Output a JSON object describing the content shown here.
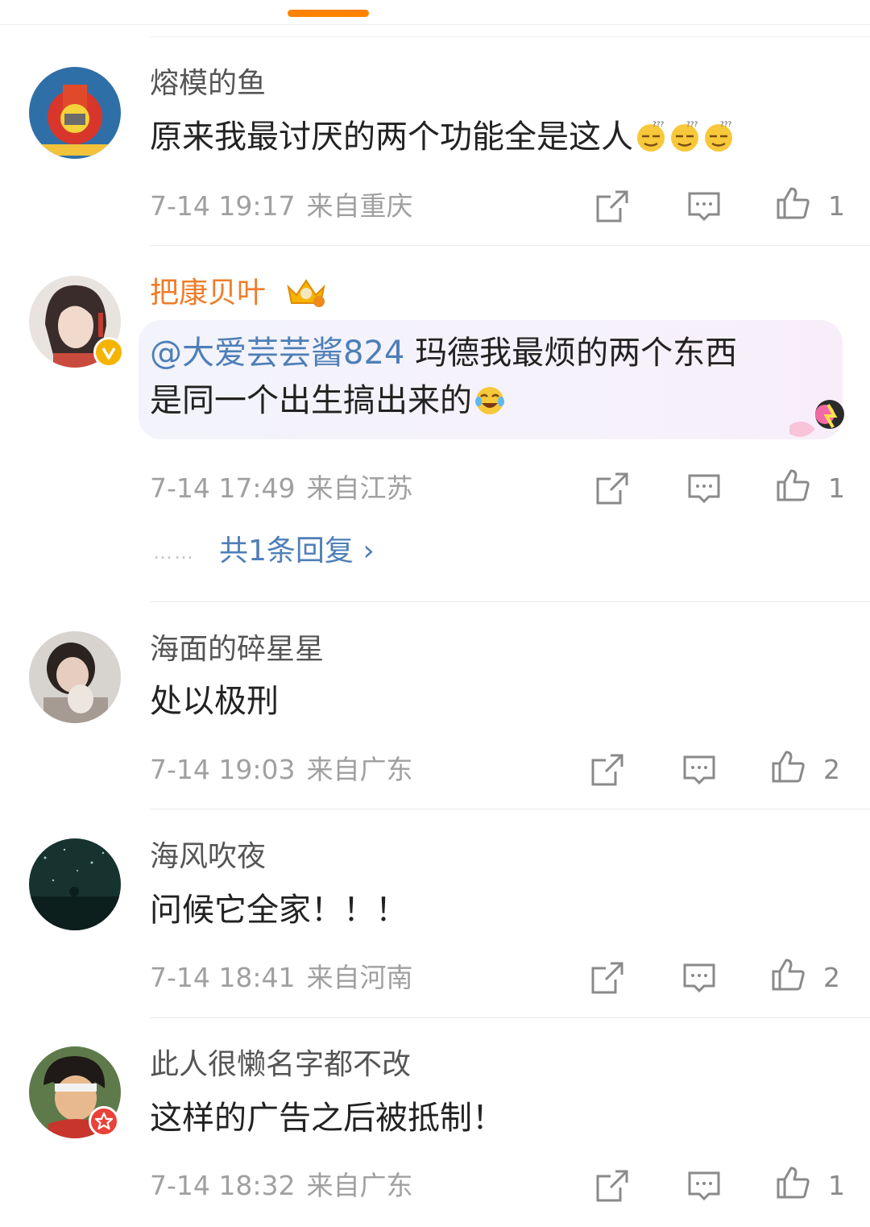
{
  "comments": [
    {
      "username": "熔模的鱼",
      "text": "原来我最讨厌的两个功能全是这人",
      "emoji_count": 3,
      "time": "7-14 19:17",
      "location": "来自重庆",
      "likes": "1"
    },
    {
      "username": "把康贝叶",
      "mention": "@大爱芸芸酱824",
      "text_line1": " 玛德我最烦的两个东西",
      "text_line2": "是同一个出生搞出来的",
      "time": "7-14 17:49",
      "location": "来自江苏",
      "likes": "1",
      "replies_dots": "……",
      "replies_label": "共1条回复 ›"
    },
    {
      "username": "海面的碎星星",
      "text": "处以极刑",
      "time": "7-14 19:03",
      "location": "来自广东",
      "likes": "2"
    },
    {
      "username": "海风吹夜",
      "text": "问候它全家！！！",
      "time": "7-14 18:41",
      "location": "来自河南",
      "likes": "2"
    },
    {
      "username": "此人很懒名字都不改",
      "text": "这样的广告之后被抵制！",
      "time": "7-14 18:32",
      "location": "来自广东",
      "likes": "1"
    }
  ],
  "icons": {
    "share": "share-icon",
    "comment": "comment-icon",
    "like": "like-icon",
    "crown": "crown-badge-icon",
    "verified": "verified-badge-icon",
    "emoji_dizzy": "dizzy-face-emoji",
    "emoji_laugh": "laughing-tears-emoji"
  },
  "colors": {
    "accent": "#ff8200",
    "link": "#4e7fb8",
    "vip_name": "#f07c28",
    "meta": "#a0a0a0"
  }
}
